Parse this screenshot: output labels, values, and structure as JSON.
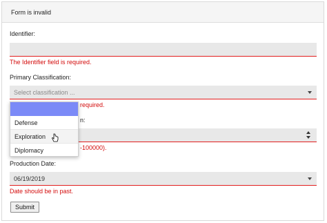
{
  "panel": {
    "title": "Form is invalid"
  },
  "identifier": {
    "label": "Identifier:",
    "value": "",
    "error": "The Identifier field is required."
  },
  "classification": {
    "label": "Primary Classification:",
    "placeholder": "Select classification ...",
    "error_visible": "required.",
    "options": [
      "",
      "Defense",
      "Exploration",
      "Diplomacy"
    ],
    "highlighted_option": "",
    "hovered_option": "Exploration"
  },
  "secondary": {
    "label_visible": "n:",
    "error_visible": "-100000)."
  },
  "production_date": {
    "label": "Production Date:",
    "value": "06/19/2019",
    "error": "Date should be in past."
  },
  "submit_label": "Submit",
  "colors": {
    "error_red": "#d30b0b",
    "field_bg": "#e8e8e8",
    "dropdown_highlight": "#7b8af7"
  }
}
